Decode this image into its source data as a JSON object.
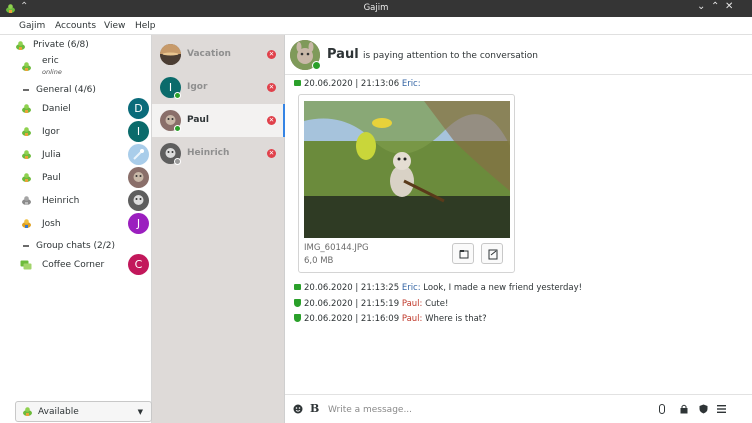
{
  "window": {
    "title": "Gajim"
  },
  "menu": [
    "Gajim",
    "Accounts",
    "View",
    "Help"
  ],
  "roster": {
    "account": "Private (6/8)",
    "self": {
      "name": "eric",
      "status": "online"
    },
    "groups": [
      {
        "label": "General (4/6)"
      },
      {
        "label": "Group chats (2/2)"
      }
    ],
    "contacts": [
      {
        "name": "Daniel",
        "avatar_letter": "D",
        "avatar_color": "#0a6b7a"
      },
      {
        "name": "Igor",
        "avatar_letter": "I",
        "avatar_color": "#0b6b6b"
      },
      {
        "name": "Julia",
        "avatar_letter": "",
        "avatar_color": "#9cc3e6"
      },
      {
        "name": "Paul",
        "avatar_letter": "",
        "avatar_color": "#8a6f6a"
      },
      {
        "name": "Heinrich",
        "avatar_letter": "",
        "avatar_color": "#6f6f6f"
      },
      {
        "name": "Josh",
        "avatar_letter": "J",
        "avatar_color": "#9b1fbf"
      }
    ],
    "groupchats": [
      {
        "name": "Coffee Corner",
        "avatar_letter": "C",
        "avatar_color": "#c2185b"
      }
    ],
    "status_selector": "Available"
  },
  "chats": [
    {
      "name": "Vacation",
      "avatar_letter": "",
      "avatar_color": "#6b5a4a"
    },
    {
      "name": "Igor",
      "avatar_letter": "I",
      "avatar_color": "#0b6b6b"
    },
    {
      "name": "Paul",
      "avatar_letter": "",
      "avatar_color": "#8a6f6a"
    },
    {
      "name": "Heinrich",
      "avatar_letter": "",
      "avatar_color": "#6f6f6f"
    }
  ],
  "conversation": {
    "name": "Paul",
    "status": "is paying attention to the conversation",
    "messages": [
      {
        "time": "20.06.2020 | 21:13:06",
        "nick": "Eric:",
        "text": ""
      },
      {
        "time": "20.06.2020 | 21:13:25",
        "nick": "Eric:",
        "text": "Look, I made a new friend yesterday!"
      },
      {
        "time": "20.06.2020 | 21:15:19",
        "nick": "Paul:",
        "text": "Cute!"
      },
      {
        "time": "20.06.2020 | 21:16:09",
        "nick": "Paul:",
        "text": "Where is that?"
      }
    ],
    "file": {
      "name": "IMG_60144.JPG",
      "size": "6,0 MB"
    },
    "composer_placeholder": "Write a message..."
  },
  "colors": {
    "online": "#2aa02a",
    "close": "#e0414b",
    "selection": "#3584e4",
    "chatlist_bg": "#dedad8"
  }
}
